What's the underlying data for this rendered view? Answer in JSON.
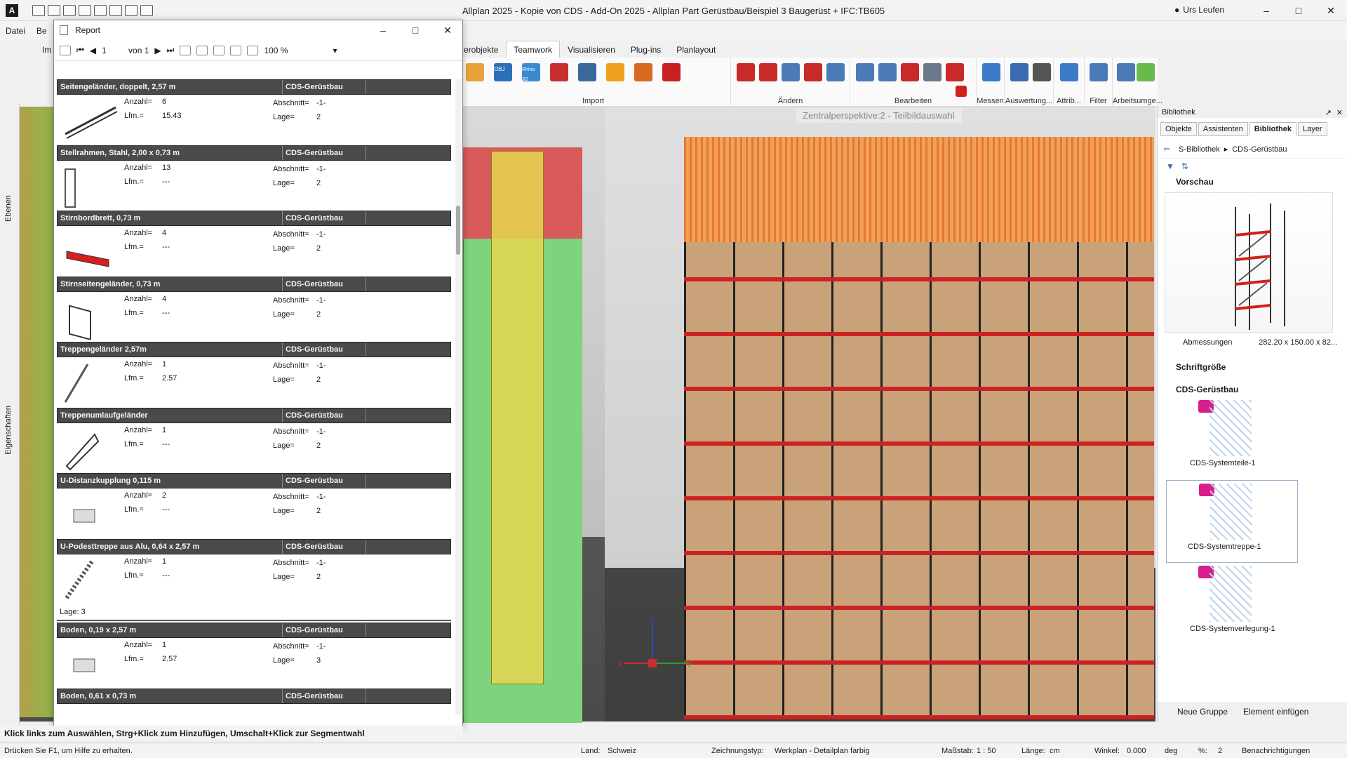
{
  "window": {
    "title": "Allplan 2025 - Kopie von CDS - Add-On 2025 - Allplan Part Gerüstbau/Beispiel 3 Baugerüst + IFC:TB605",
    "user": "Urs Leufen"
  },
  "menu": [
    "Datei",
    "Be",
    "Im"
  ],
  "ribbon_tabs": [
    "erobjekte",
    "Teamwork",
    "Visualisieren",
    "Plug-ins",
    "Planlayout"
  ],
  "ribbon_groups": [
    "Import",
    "Ändern",
    "Bearbeiten",
    "Messen",
    "Auswertung...",
    "Attrib...",
    "Filter",
    "Arbeitsumge..."
  ],
  "ribbon_icon_texts": [
    "OBJ",
    "Rhino 3D"
  ],
  "left_panels": [
    "Ebenen",
    "Eigenschaften"
  ],
  "viewport": {
    "label": "Zentralperspektive:2 - Teilbildauswahl",
    "axes": [
      "Z",
      "X",
      "Y"
    ]
  },
  "report": {
    "title": "Report",
    "page": "1",
    "page_of": "von 1",
    "zoom": "100 %",
    "category": "CDS-Gerüstbau",
    "field_labels": {
      "anzahl": "Anzahl=",
      "lfm": "Lfm.=",
      "abschnitt": "Abschnitt=",
      "lage": "Lage="
    },
    "items": [
      {
        "name": "Seitengeländer, doppelt, 2,57 m",
        "anzahl": "6",
        "lfm": "15.43",
        "abschnitt": "-1-",
        "lage": "2"
      },
      {
        "name": "Stellrahmen, Stahl, 2,00 x 0,73 m",
        "anzahl": "13",
        "lfm": "---",
        "abschnitt": "-1-",
        "lage": "2"
      },
      {
        "name": "Stirnbordbrett, 0,73 m",
        "anzahl": "4",
        "lfm": "---",
        "abschnitt": "-1-",
        "lage": "2"
      },
      {
        "name": "Stirnseitengeländer, 0,73 m",
        "anzahl": "4",
        "lfm": "---",
        "abschnitt": "-1-",
        "lage": "2"
      },
      {
        "name": "Treppengeländer 2,57m",
        "anzahl": "1",
        "lfm": "2.57",
        "abschnitt": "-1-",
        "lage": "2"
      },
      {
        "name": "Treppenumlaufgeländer",
        "anzahl": "1",
        "lfm": "---",
        "abschnitt": "-1-",
        "lage": "2"
      },
      {
        "name": "U-Distanzkupplung 0,115 m",
        "anzahl": "2",
        "lfm": "---",
        "abschnitt": "-1-",
        "lage": "2"
      },
      {
        "name": "U-Podesttreppe aus Alu, 0,64 x 2,57 m",
        "anzahl": "1",
        "lfm": "---",
        "abschnitt": "-1-",
        "lage": "2"
      }
    ],
    "lage_header": "Lage: 3",
    "items2": [
      {
        "name": "Boden, 0,19 x 2,57 m",
        "anzahl": "1",
        "lfm": "2.57",
        "abschnitt": "-1-",
        "lage": "3"
      },
      {
        "name": "Boden, 0,61 x 0,73 m"
      }
    ]
  },
  "hint": "Klick links zum Auswählen, Strg+Klick zum Hinzufügen, Umschalt+Klick zur Segmentwahl",
  "library": {
    "panel_title": "Bibliothek",
    "tabs": [
      "Objekte",
      "Assistenten",
      "Bibliothek",
      "Layer"
    ],
    "breadcrumb": [
      "S-Bibliothek",
      "CDS-Gerüstbau"
    ],
    "preview_section": "Vorschau",
    "dim_label": "Abmessungen",
    "dim_value": "282.20 x 150.00 x 82...",
    "section_font": "Schriftgröße",
    "section_cds": "CDS-Gerüstbau",
    "items": [
      "CDS-Systemteile-1",
      "CDS-Systemtreppe-1",
      "CDS-Systemverlegung-1"
    ],
    "new_group": "Neue Gruppe",
    "insert": "Element einfügen"
  },
  "status": {
    "help": "Drücken Sie F1, um Hilfe zu erhalten.",
    "land_label": "Land:",
    "land": "Schweiz",
    "ztyp_label": "Zeichnungstyp:",
    "ztyp": "Werkplan - Detailplan farbig",
    "scale_label": "Maßstab:",
    "scale": "1 : 50",
    "len_label": "Länge:",
    "len": "cm",
    "angle_label": "Winkel:",
    "angle": "0.000",
    "angle_unit": "deg",
    "pct_label": "%:",
    "pct": "2",
    "notif": "Benachrichtigungen"
  },
  "colors": {
    "accent": "#d81e8a",
    "scaffold_red": "#cc2222",
    "net_orange": "#e47a2f",
    "report_header": "#4a4a4a"
  }
}
